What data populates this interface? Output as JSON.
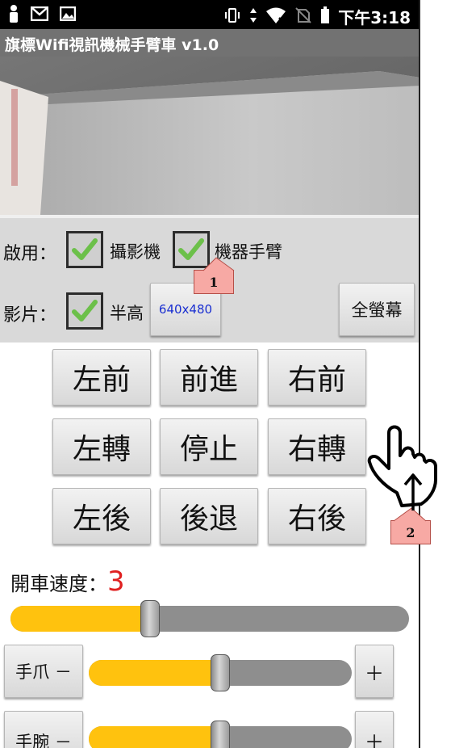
{
  "status_bar": {
    "time": "下午3:18"
  },
  "app": {
    "title": "旗標Wifi視訊機械手臂車 v1.0"
  },
  "enable_row": {
    "label": "啟用：",
    "camera_label": "攝影機",
    "camera_checked": true,
    "arm_label": "機器手臂",
    "arm_checked": true
  },
  "video_row": {
    "label": "影片：",
    "half_height_label": "半高",
    "half_height_checked": true,
    "resolution_button": "640x480",
    "fullscreen_button": "全螢幕"
  },
  "movement": {
    "forward_left": "左前",
    "forward": "前進",
    "forward_right": "右前",
    "turn_left": "左轉",
    "stop": "停止",
    "turn_right": "右轉",
    "back_left": "左後",
    "backward": "後退",
    "back_right": "右後"
  },
  "speed": {
    "label": "開車速度：",
    "value": "3",
    "level": 0.35
  },
  "claw": {
    "label": "手爪 －",
    "plus": "＋",
    "level": 0.5
  },
  "wrist": {
    "label": "手腕 －",
    "plus": "＋",
    "level": 0.5
  },
  "annotations": {
    "callout_1": "1",
    "callout_2": "2"
  },
  "colors": {
    "accent": "#ffc20e",
    "speed_value": "#e02020",
    "check": "#6cc04a"
  },
  "icons": [
    "person-icon",
    "mail-icon",
    "image-icon",
    "vibrate-icon",
    "data-arrows-icon",
    "wifi-icon",
    "no-sim-icon",
    "battery-icon",
    "check-icon",
    "hand-pointer-icon"
  ]
}
